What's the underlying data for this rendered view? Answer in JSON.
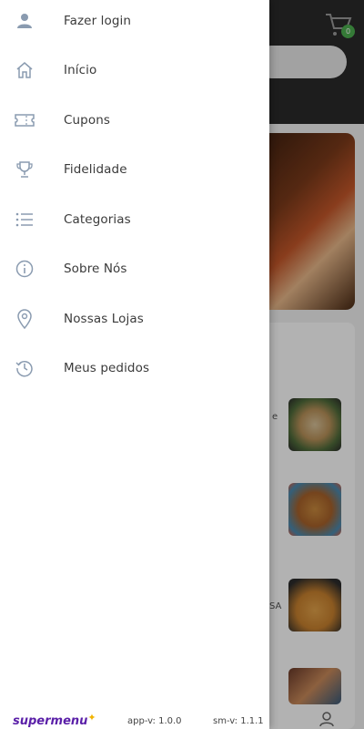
{
  "background": {
    "cart_badge": "0",
    "item_text_1": "e",
    "item_text_2": "SA"
  },
  "drawer": {
    "items": [
      {
        "label": "Fazer login",
        "icon": "user-icon"
      },
      {
        "label": "Início",
        "icon": "home-icon"
      },
      {
        "label": "Cupons",
        "icon": "ticket-icon"
      },
      {
        "label": "Fidelidade",
        "icon": "trophy-icon"
      },
      {
        "label": "Categorias",
        "icon": "list-icon"
      },
      {
        "label": "Sobre Nós",
        "icon": "info-icon"
      },
      {
        "label": "Nossas Lojas",
        "icon": "location-pin-icon"
      },
      {
        "label": "Meus pedidos",
        "icon": "history-icon"
      }
    ],
    "footer": {
      "logo": "supermenu",
      "app_version": "app-v: 1.0.0",
      "sm_version": "sm-v: 1.1.1"
    }
  },
  "colors": {
    "brand": "#5a1fa8",
    "brand_accent": "#f2b300",
    "icon": "#8a9bb0",
    "badge": "#4caf50"
  }
}
